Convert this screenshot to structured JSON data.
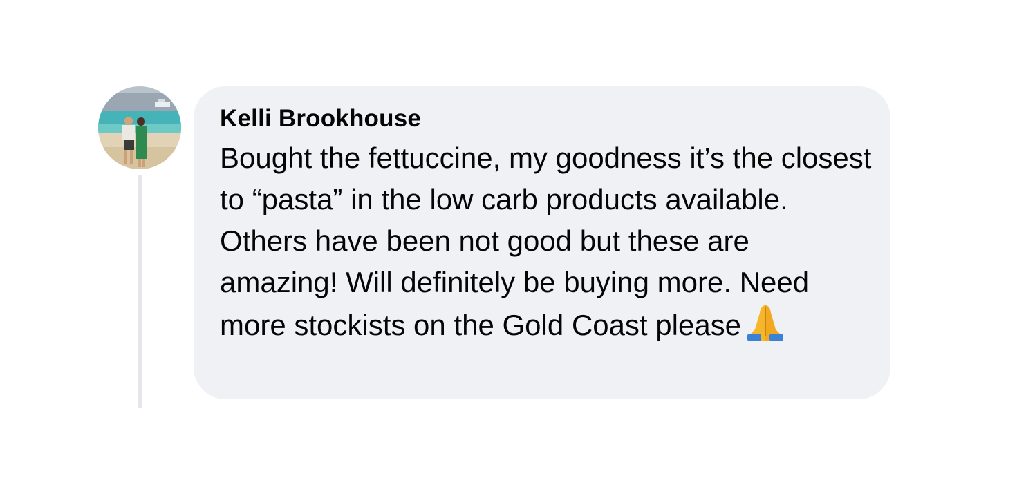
{
  "comment": {
    "author_name": "Kelli Brookhouse",
    "body_text": "Bought the fettuccine, my goodness it’s the closest to “pasta” in the low carb products available. Others have been not good but these are amazing! Will definitely be buying more. Need more stockists on the Gold Coast please",
    "trailing_emoji_icon": "folded-hands-icon",
    "avatar_icon": "profile-photo-avatar"
  },
  "colors": {
    "bubble_background": "#f0f1f5",
    "text": "#050505",
    "thread_line": "#e4e6eb"
  }
}
